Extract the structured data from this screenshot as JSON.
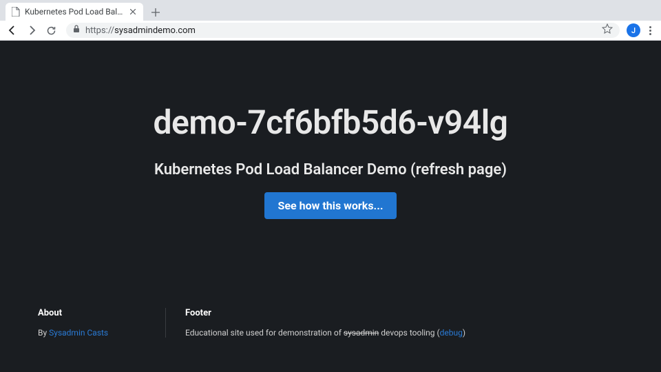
{
  "browser": {
    "tab_title": "Kubernetes Pod Load Balancer",
    "url_scheme": "https://",
    "url_host": "sysadmindemo.com",
    "avatar_initial": "J"
  },
  "hero": {
    "title": "demo-7cf6bfb5d6-v94lg",
    "subtitle": "Kubernetes Pod Load Balancer Demo (refresh page)",
    "button_label": "See how this works..."
  },
  "footer": {
    "about": {
      "heading": "About",
      "prefix": "By ",
      "link_text": "Sysadmin Casts"
    },
    "foot": {
      "heading": "Footer",
      "text_before": "Educational site used for demonstration of ",
      "struck_word": "sysadmin",
      "text_mid": " devops tooling (",
      "link_text": "debug",
      "text_after": ")"
    }
  }
}
